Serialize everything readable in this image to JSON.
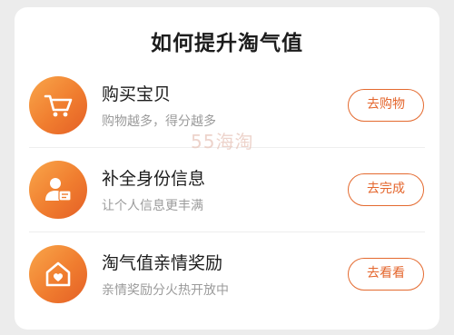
{
  "title": "如何提升淘气值",
  "tasks": [
    {
      "name": "购买宝贝",
      "desc": "购物越多，得分越多",
      "button": "去购物",
      "icon": "shopping-cart-icon"
    },
    {
      "name": "补全身份信息",
      "desc": "让个人信息更丰满",
      "button": "去完成",
      "icon": "profile-card-icon"
    },
    {
      "name": "淘气值亲情奖励",
      "desc": "亲情奖励分火热开放中",
      "button": "去看看",
      "icon": "home-heart-icon"
    }
  ],
  "watermark": "55海淘",
  "colors": {
    "accent": "#e4662d",
    "gradient_start": "#f9a64a",
    "gradient_end": "#e45f26"
  }
}
